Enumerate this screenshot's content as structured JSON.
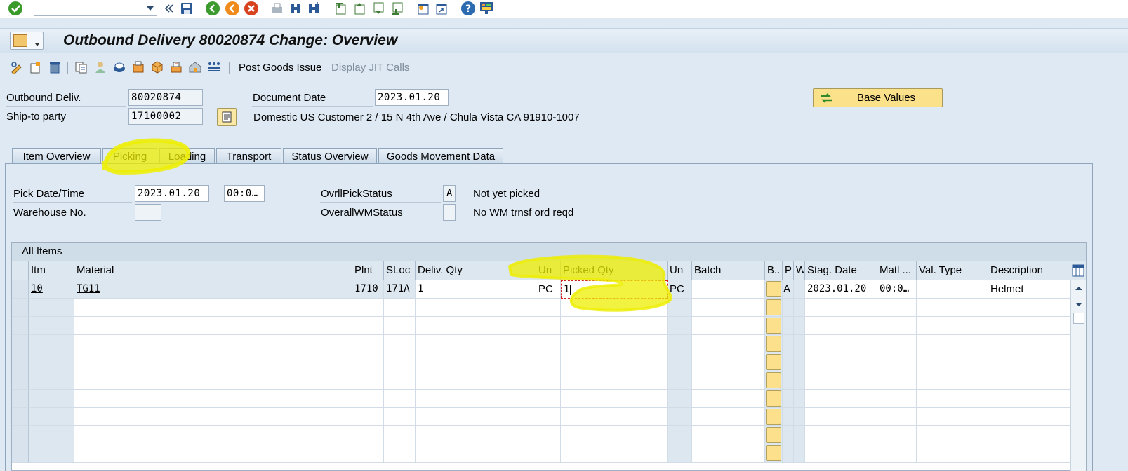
{
  "command_field": {
    "value": ""
  },
  "title": "Outbound Delivery 80020874 Change: Overview",
  "app_toolbar": {
    "post_goods_issue": "Post Goods Issue",
    "display_jit_calls": "Display JIT Calls"
  },
  "header": {
    "outbound_deliv_label": "Outbound Deliv.",
    "outbound_deliv_value": "80020874",
    "ship_to_label": "Ship-to party",
    "ship_to_value": "17100002",
    "document_date_label": "Document Date",
    "document_date_value": "2023.01.20",
    "ship_to_address": "Domestic US Customer 2 / 15 N 4th Ave / Chula Vista CA 91910-1007",
    "base_values_label": "Base Values"
  },
  "tabs": [
    {
      "label": "Item Overview"
    },
    {
      "label": "Picking",
      "active": true
    },
    {
      "label": "Loading"
    },
    {
      "label": "Transport"
    },
    {
      "label": "Status Overview"
    },
    {
      "label": "Goods Movement Data"
    }
  ],
  "picking": {
    "pick_date_label": "Pick Date/Time",
    "pick_date_value": "2023.01.20",
    "pick_time_value": "00:0…",
    "warehouse_label": "Warehouse No.",
    "warehouse_value": "",
    "ovrl_pick_status_label": "OvrllPickStatus",
    "ovrl_pick_status_value": "A",
    "ovrl_pick_status_text": "Not yet picked",
    "overall_wm_status_label": "OverallWMStatus",
    "overall_wm_status_value": "",
    "overall_wm_status_text": "No WM trnsf ord reqd"
  },
  "items_table": {
    "title": "All Items",
    "columns": [
      "Itm",
      "Material",
      "Plnt",
      "SLoc",
      "Deliv. Qty",
      "Un",
      "Picked Qty",
      "Un",
      "Batch",
      "B..",
      "P",
      "W",
      "Stag. Date",
      "Matl ...",
      "Val. Type",
      "Description"
    ],
    "rows": [
      {
        "itm": "10",
        "material": "TG11",
        "plnt": "1710",
        "sloc": "171A",
        "deliv_qty": "1",
        "un": "PC",
        "picked_qty": "1",
        "picked_un": "PC",
        "batch": "",
        "b": "",
        "p": "A",
        "w": "",
        "stag_date": "2023.01.20",
        "matl_time": "00:0…",
        "val_type": "",
        "description": "Helmet"
      }
    ]
  },
  "colors": {
    "background": "#dfe9f3",
    "button_yellow": "#fbe18a",
    "highlight": "#f0f000"
  }
}
